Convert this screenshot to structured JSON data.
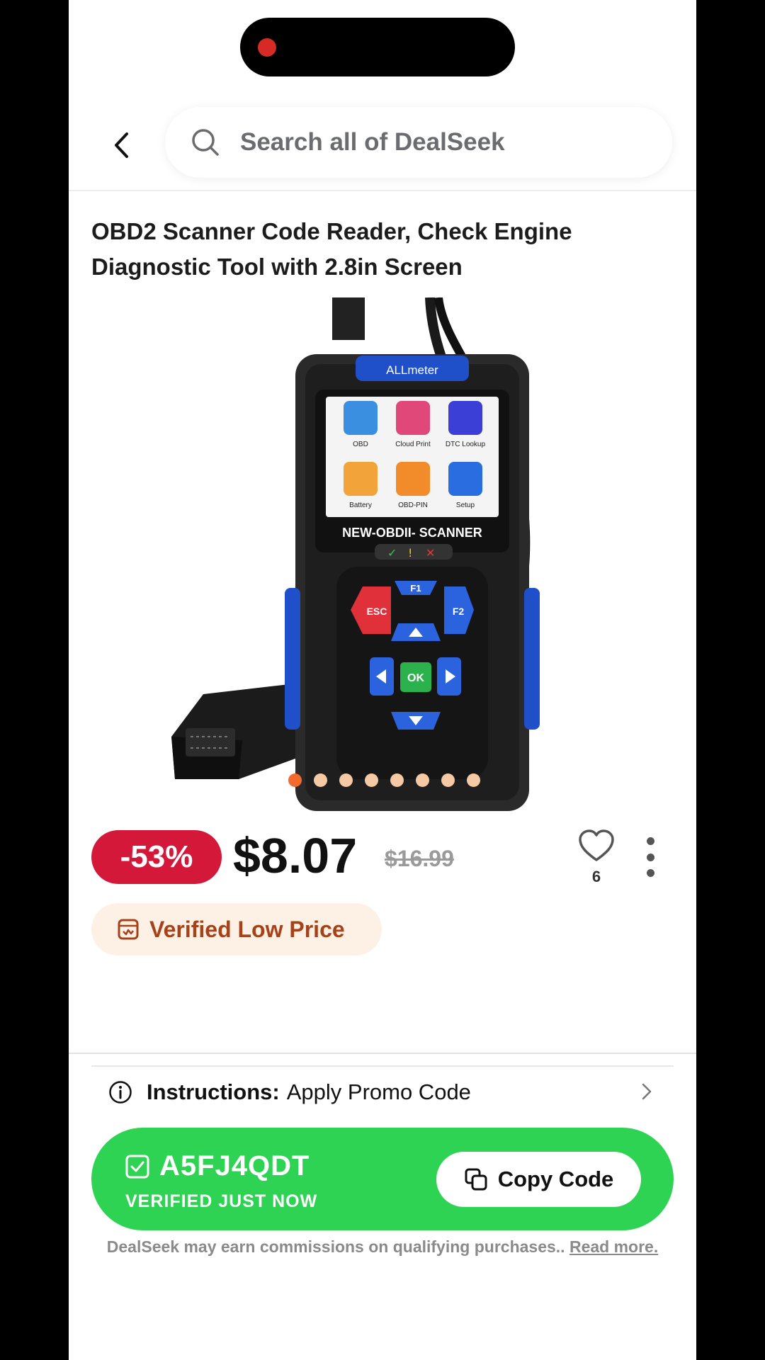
{
  "search": {
    "placeholder": "Search all of DealSeek"
  },
  "product": {
    "title": "OBD2 Scanner Code Reader, Check Engine Diagnostic Tool with 2.8in Screen",
    "image": {
      "brand": "ALLmeter",
      "screen_label": "NEW-OBDII- SCANNER",
      "apps": [
        "OBD",
        "Cloud Print",
        "DTC Lookup",
        "Battery",
        "OBD-PIN",
        "Setup"
      ],
      "keys": [
        "F1",
        "ESC",
        "F2",
        "OK"
      ]
    },
    "carousel": {
      "count": 8,
      "active_index": 0
    },
    "discount": "-53%",
    "price": "$8.07",
    "original_price": "$16.99",
    "favorites_count": "6",
    "badge": "Verified Low Price"
  },
  "instructions": {
    "label": "Instructions:",
    "text": "Apply Promo Code"
  },
  "coupon": {
    "code": "A5FJ4QDT",
    "verified": "VERIFIED JUST NOW",
    "copy_label": "Copy Code"
  },
  "disclaimer": {
    "text": "DealSeek may earn commissions on qualifying purchases..",
    "link": "Read more."
  },
  "colors": {
    "discount_bg": "#d4183a",
    "coupon_bg": "#2fd353",
    "badge_bg": "#fdf1e6",
    "badge_text": "#a5421a",
    "dot_active": "#f26b2c",
    "dot_inactive": "#f5c9a3"
  }
}
